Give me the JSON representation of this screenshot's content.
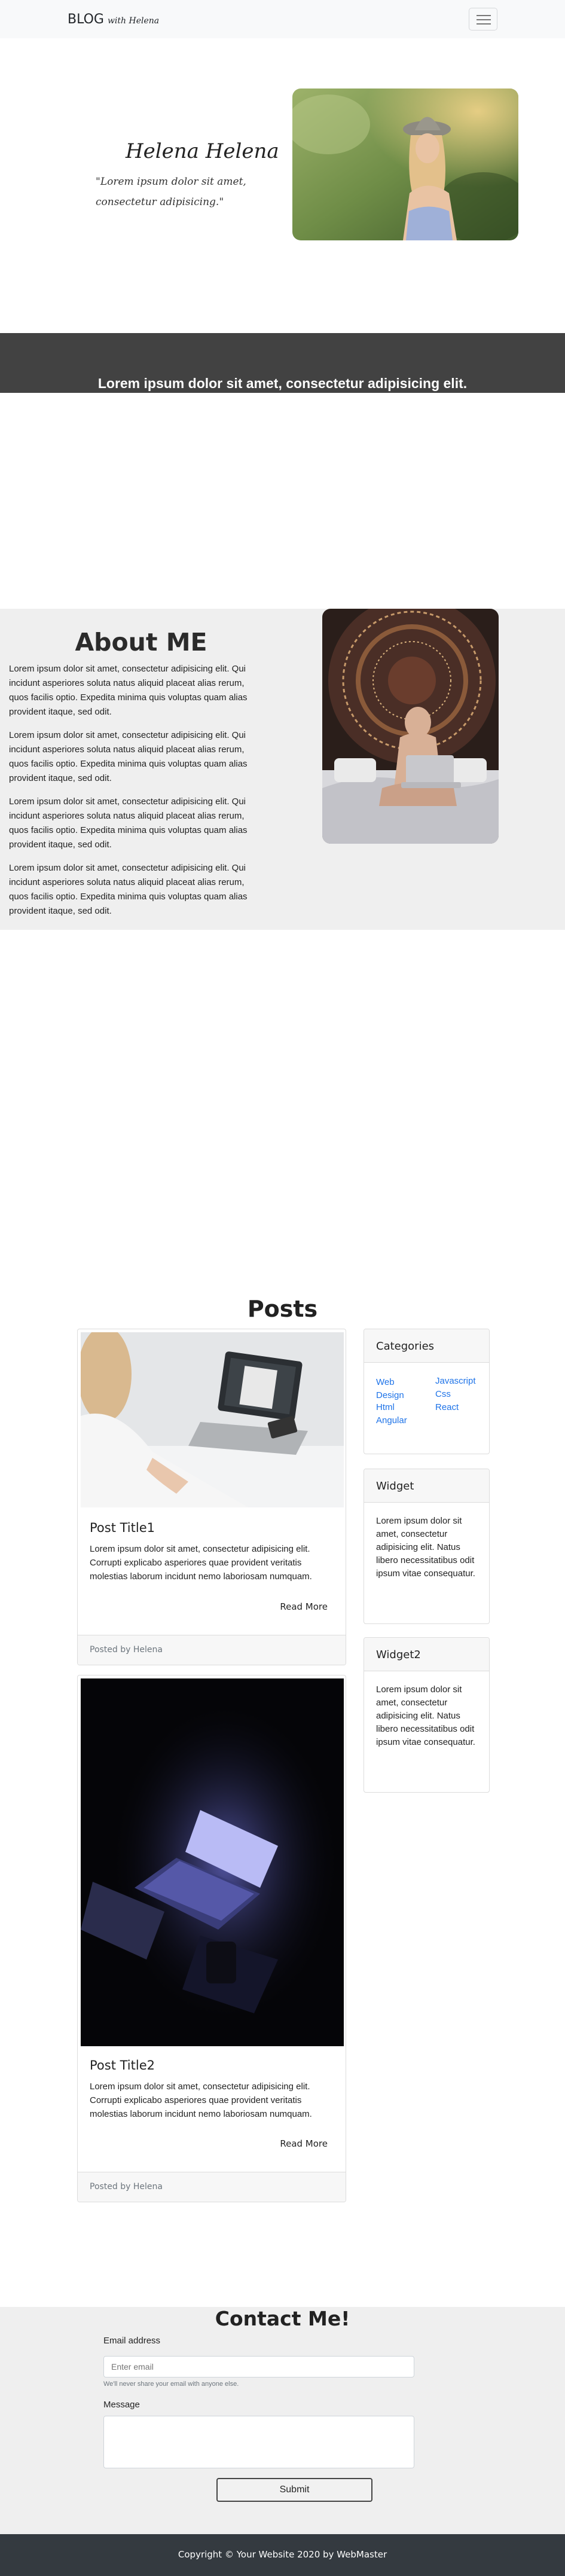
{
  "navbar": {
    "brand": "BLOG",
    "brand_script": "with Helena"
  },
  "hero": {
    "name": "Helena Helena",
    "quote": "\"Lorem ipsum dolor sit amet, consectetur adipisicing.\""
  },
  "banner": {
    "text": "Lorem ipsum dolor sit amet, consectetur adipisicing elit."
  },
  "about": {
    "title": "About ME",
    "paragraphs": [
      "Lorem ipsum dolor sit amet, consectetur adipisicing elit. Qui incidunt asperiores soluta natus aliquid placeat alias rerum, quos facilis optio. Expedita minima quis voluptas quam alias provident itaque, sed odit.",
      "Lorem ipsum dolor sit amet, consectetur adipisicing elit. Qui incidunt asperiores soluta natus aliquid placeat alias rerum, quos facilis optio. Expedita minima quis voluptas quam alias provident itaque, sed odit.",
      "Lorem ipsum dolor sit amet, consectetur adipisicing elit. Qui incidunt asperiores soluta natus aliquid placeat alias rerum, quos facilis optio. Expedita minima quis voluptas quam alias provident itaque, sed odit.",
      "Lorem ipsum dolor sit amet, consectetur adipisicing elit. Qui incidunt asperiores soluta natus aliquid placeat alias rerum, quos facilis optio. Expedita minima quis voluptas quam alias provident itaque, sed odit."
    ]
  },
  "posts": {
    "title": "Posts",
    "items": [
      {
        "title": "Post Title1",
        "text": "Lorem ipsum dolor sit amet, consectetur adipisicing elit. Corrupti explicabo asperiores quae provident veritatis molestias laborum incidunt nemo laboriosam numquam.",
        "read_more": "Read More",
        "footer": "Posted by Helena"
      },
      {
        "title": "Post Title2",
        "text": "Lorem ipsum dolor sit amet, consectetur adipisicing elit. Corrupti explicabo asperiores quae provident veritatis molestias laborum incidunt nemo laboriosam numquam.",
        "read_more": "Read More",
        "footer": "Posted by Helena"
      }
    ]
  },
  "sidebar": {
    "categories": {
      "title": "Categories",
      "links": [
        "Web Design",
        "Html",
        "Angular",
        "Javascript",
        "Css",
        "React"
      ]
    },
    "widget": {
      "title": "Widget",
      "text": "Lorem ipsum dolor sit amet, consectetur adipisicing elit. Natus libero necessitatibus odit ipsum vitae consequatur."
    },
    "widget2": {
      "title": "Widget2",
      "text": "Lorem ipsum dolor sit amet, consectetur adipisicing elit. Natus libero necessitatibus odit ipsum vitae consequatur."
    }
  },
  "contact": {
    "title": "Contact Me!",
    "email_label": "Email address",
    "email_placeholder": "Enter email",
    "email_help": "We'll never share your email with anyone else.",
    "message_label": "Message",
    "submit_label": "Submit"
  },
  "footer": {
    "text": "Copyright © Your Website 2020 by WebMaster"
  }
}
